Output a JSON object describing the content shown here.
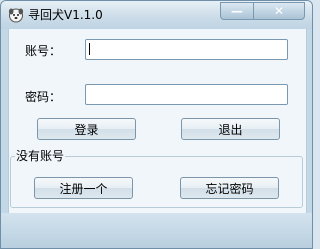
{
  "window": {
    "title": "寻回犬V1.1.0",
    "minimize_glyph": "—",
    "close_glyph": "✕"
  },
  "form": {
    "account_label": "账号：",
    "account_value": "",
    "password_label": "密码：",
    "password_value": ""
  },
  "buttons": {
    "login": "登录",
    "exit": "退出"
  },
  "no_account_group": {
    "title": "没有账号",
    "register": "注册一个",
    "forgot_password": "忘记密码"
  },
  "icons": {
    "app": "dog-face-icon",
    "minimize": "minimize-icon",
    "close": "close-icon"
  }
}
